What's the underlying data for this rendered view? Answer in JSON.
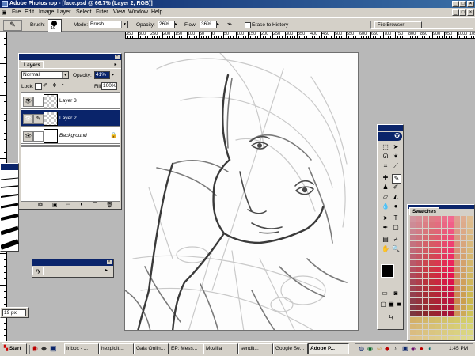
{
  "window": {
    "title": "Adobe Photoshop - [face.psd @ 66.7% (Layer 2, RGB)]"
  },
  "menu": [
    "File",
    "Edit",
    "Image",
    "Layer",
    "Select",
    "Filter",
    "View",
    "Window",
    "Help"
  ],
  "options": {
    "brush_label": "Brush:",
    "brush_size": "19",
    "mode_label": "Mode:",
    "mode_value": "Brush",
    "opacity_label": "Opacity:",
    "opacity_value": "26%",
    "flow_label": "Flow:",
    "flow_value": "36%",
    "erase_history": "Erase to History",
    "file_browser": "File Browser"
  },
  "ruler": {
    "top_labels": [
      "350",
      "300",
      "250",
      "200",
      "150",
      "100",
      "50",
      "0",
      "50",
      "100",
      "150",
      "200",
      "250",
      "300",
      "350",
      "400",
      "450",
      "500",
      "550",
      "600",
      "650",
      "700",
      "750",
      "800",
      "850",
      "900",
      "950",
      "1000",
      "1050"
    ]
  },
  "layers_panel": {
    "tab": "Layers",
    "blend_mode": "Normal",
    "opacity_label": "Opacity:",
    "opacity_value": "41%",
    "lock_label": "Lock:",
    "fill_label": "Fill:",
    "fill_value": "100%",
    "layers": [
      {
        "name": "Layer 3"
      },
      {
        "name": "Layer 2"
      },
      {
        "name": "Background"
      }
    ]
  },
  "history_panel": {
    "tab": "ry"
  },
  "brush_panel": {
    "size_value": "19 px"
  },
  "swatches_panel": {
    "tab": "Swatches"
  },
  "taskbar": {
    "start": "Start",
    "buttons": [
      {
        "label": "Inbox - ..."
      },
      {
        "label": "hexploit..."
      },
      {
        "label": "Gaia Onlin..."
      },
      {
        "label": "EP: Mess..."
      },
      {
        "label": "Mozilla"
      },
      {
        "label": "sendit..."
      },
      {
        "label": "Google Se..."
      },
      {
        "label": "Adobe P..."
      }
    ],
    "clock": "1:45 PM"
  },
  "colors": {
    "title": "#0a246a",
    "chrome": "#d4d0c8",
    "selected": "#0a246a"
  }
}
